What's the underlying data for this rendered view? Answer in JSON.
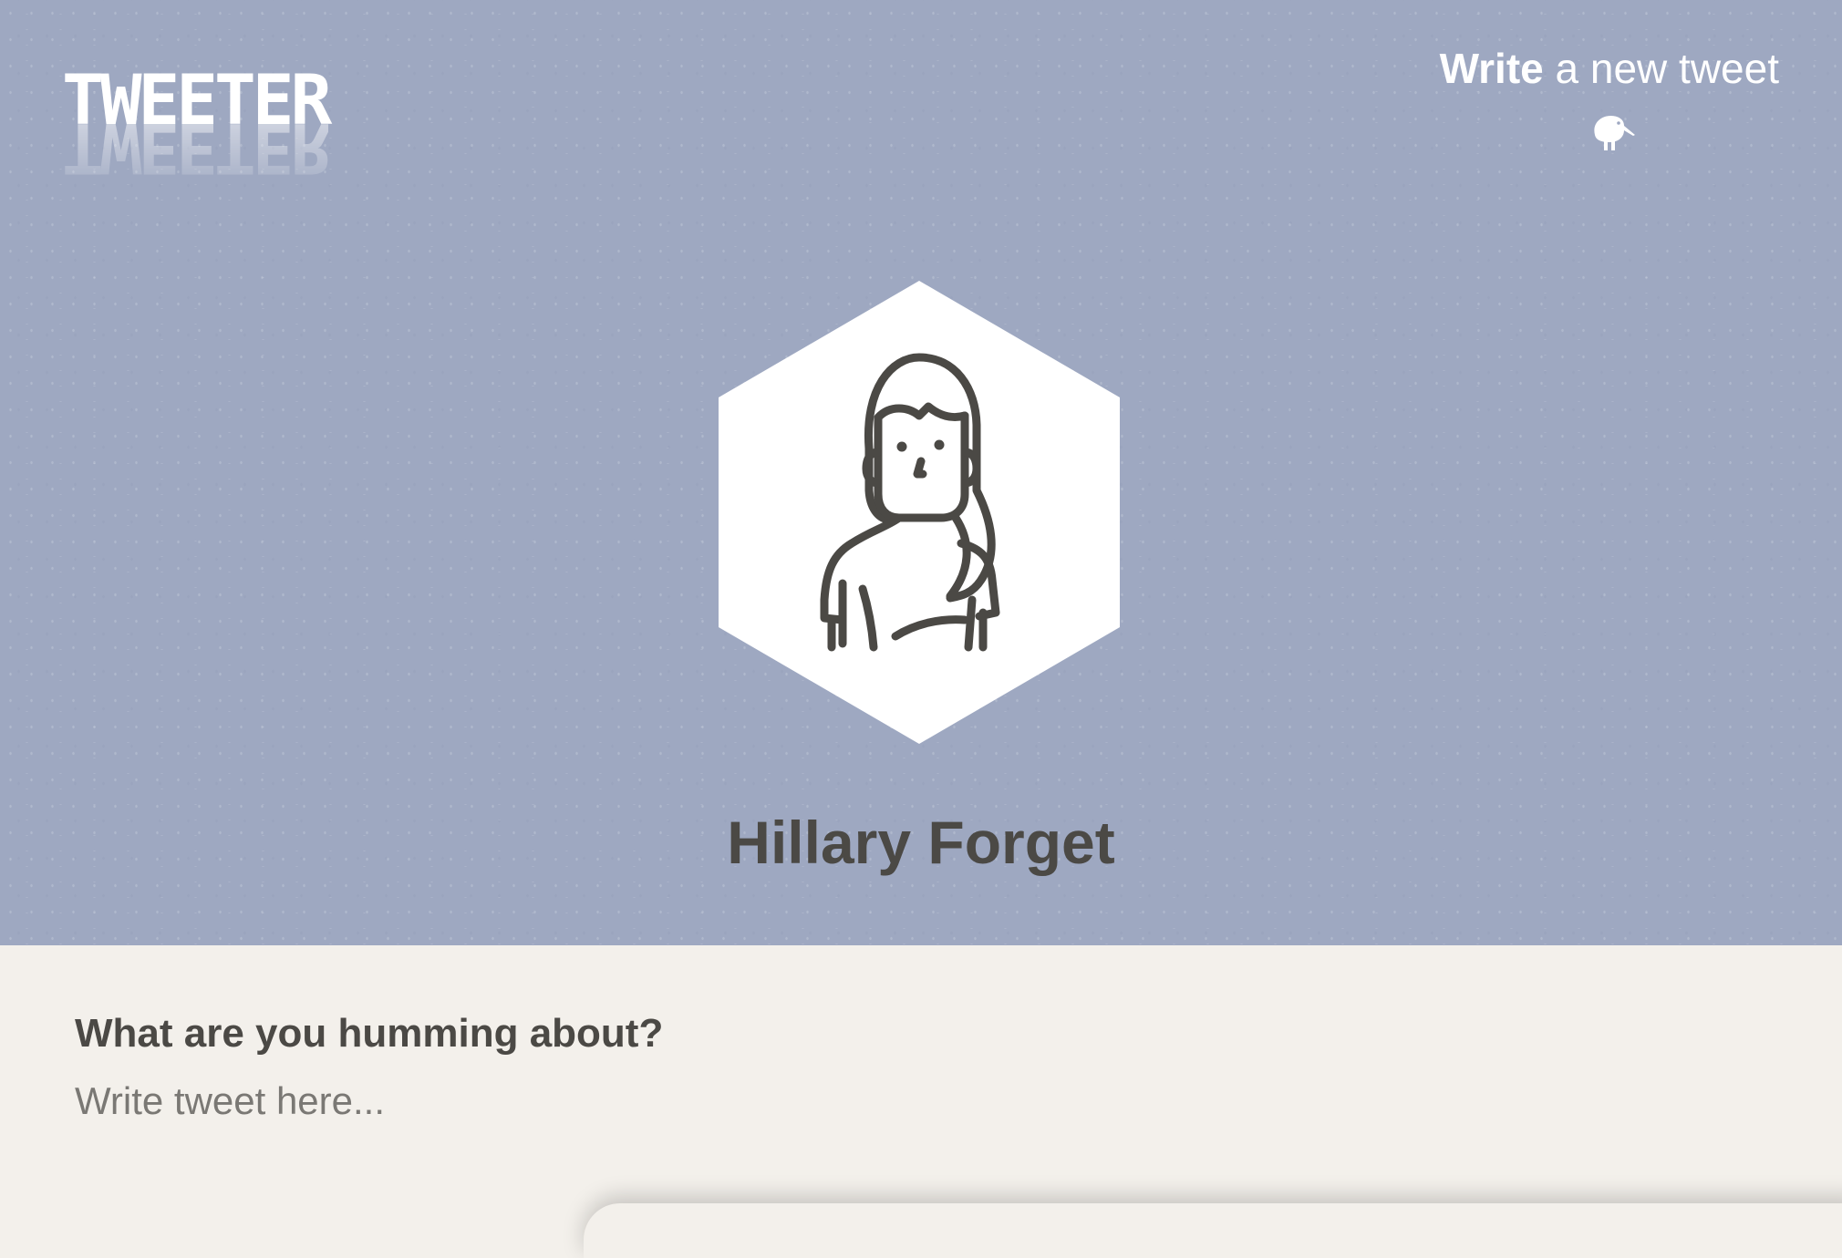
{
  "logo": {
    "text": "TWEETER"
  },
  "nav": {
    "write_bold": "Write",
    "write_rest": " a new tweet",
    "icon": "kiwi-bird-icon"
  },
  "profile": {
    "name": "Hillary Forget",
    "avatar_icon": "woman-avatar-icon"
  },
  "compose": {
    "label": "What are you humming about?",
    "placeholder": "Write tweet here...",
    "value": ""
  },
  "colors": {
    "header_bg": "#9ea8c1",
    "compose_bg": "#f3f0eb",
    "text_dark": "#4b4945",
    "white": "#ffffff"
  }
}
